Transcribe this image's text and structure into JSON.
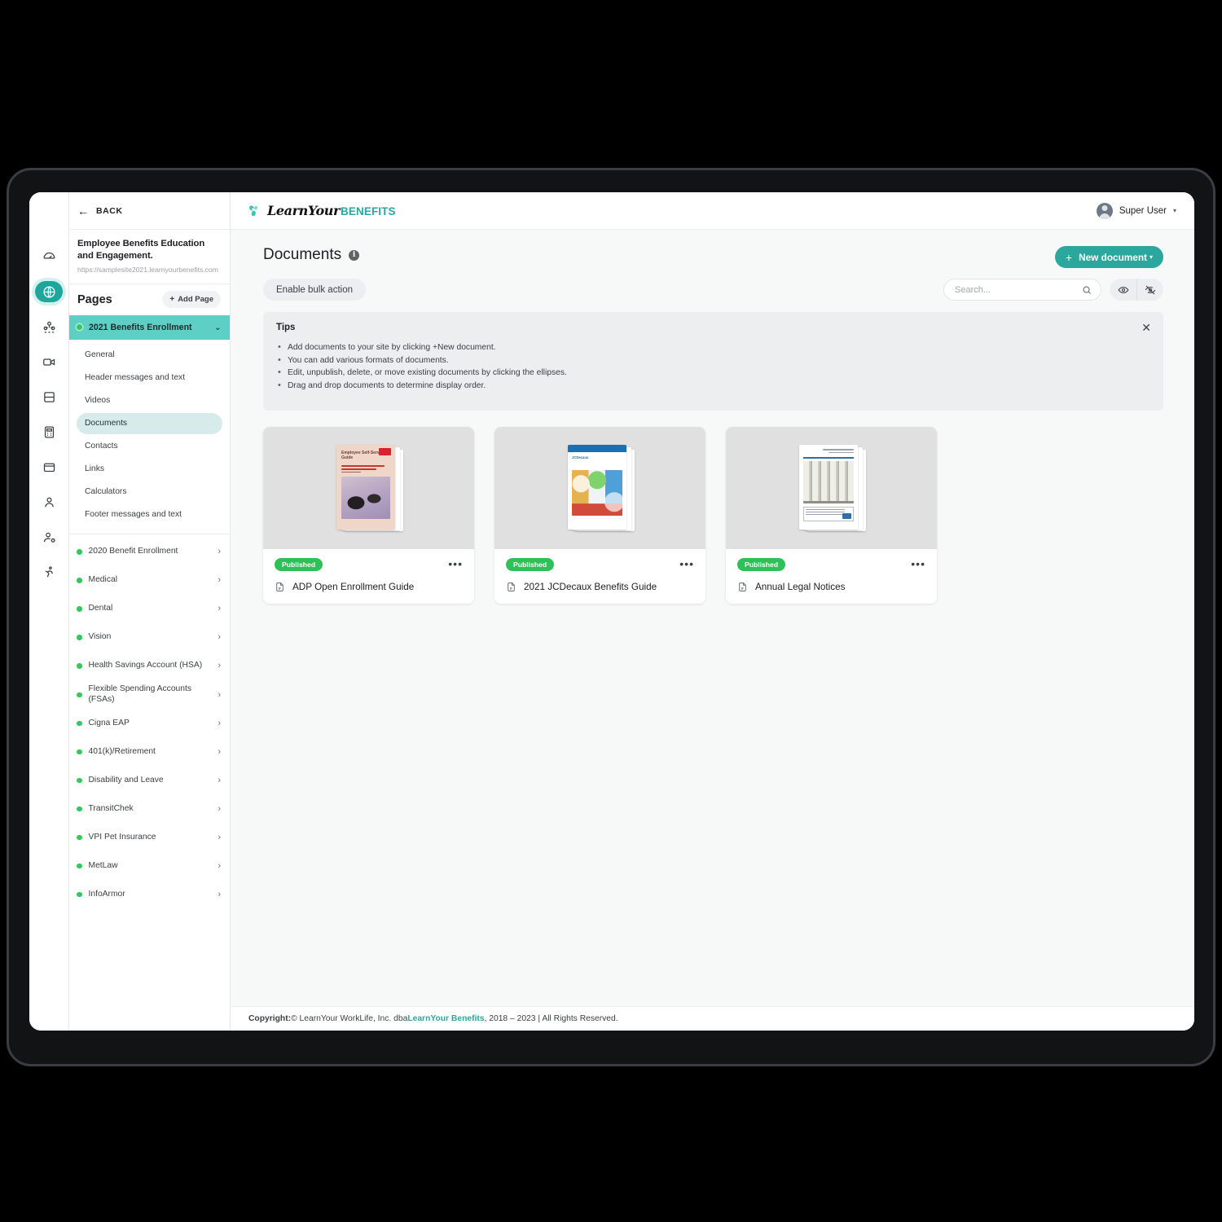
{
  "rail": {
    "items": [
      {
        "name": "dashboard-icon",
        "label": "Dashboard"
      },
      {
        "name": "globe-icon",
        "label": "Sites",
        "active": true
      },
      {
        "name": "people-group-icon",
        "label": "Groups"
      },
      {
        "name": "video-icon",
        "label": "Videos"
      },
      {
        "name": "cards-icon",
        "label": "Cards"
      },
      {
        "name": "calculator-icon",
        "label": "Calculators"
      },
      {
        "name": "folder-icon",
        "label": "Library"
      },
      {
        "name": "user-icon",
        "label": "Users"
      },
      {
        "name": "user-settings-icon",
        "label": "User settings"
      },
      {
        "name": "activity-icon",
        "label": "Activity"
      }
    ]
  },
  "sidebar": {
    "back_label": "BACK",
    "site_title": "Employee Benefits Education and Engagement.",
    "site_url": "https://samplesite2021.learnyourbenefits.com",
    "pages_heading": "Pages",
    "add_page_label": "Add Page",
    "add_page_plus": "+",
    "active_page": "2021 Benefits Enrollment",
    "subpages": [
      {
        "label": "General",
        "selected": false
      },
      {
        "label": "Header messages and text",
        "selected": false
      },
      {
        "label": "Videos",
        "selected": false
      },
      {
        "label": "Documents",
        "selected": true
      },
      {
        "label": "Contacts",
        "selected": false
      },
      {
        "label": "Links",
        "selected": false
      },
      {
        "label": "Calculators",
        "selected": false
      },
      {
        "label": "Footer messages and text",
        "selected": false
      }
    ],
    "groups": [
      {
        "label": "2020 Benefit Enrollment"
      },
      {
        "label": "Medical"
      },
      {
        "label": "Dental"
      },
      {
        "label": "Vision"
      },
      {
        "label": "Health Savings Account (HSA)"
      },
      {
        "label": "Flexible Spending Accounts (FSAs)"
      },
      {
        "label": "Cigna EAP"
      },
      {
        "label": "401(k)/Retirement"
      },
      {
        "label": "Disability and Leave"
      },
      {
        "label": "TransitChek"
      },
      {
        "label": "VPI Pet Insurance"
      },
      {
        "label": "MetLaw"
      },
      {
        "label": "InfoArmor"
      }
    ]
  },
  "header": {
    "brand_primary": "LearnYour",
    "brand_secondary": "BENEFITS",
    "user_name": "Super User",
    "user_caret": "▾"
  },
  "main": {
    "page_title": "Documents",
    "info_badge": "i",
    "new_document_label": "New document",
    "new_document_plus": "+",
    "new_document_caret": "▾",
    "bulk_action_label": "Enable bulk action",
    "search_placeholder": "Search...",
    "search_value": ""
  },
  "tips": {
    "title": "Tips",
    "close_label": "✕",
    "items": [
      "Add documents to your site by clicking +New document.",
      "You can add various formats of documents.",
      "Edit, unpublish, delete, or move existing documents by clicking the ellipses.",
      "Drag and drop documents to determine display order."
    ]
  },
  "documents": [
    {
      "name": "ADP Open Enrollment Guide",
      "status": "Published",
      "menu": "•••",
      "cover": "adp",
      "cover_text": {
        "heading": "Employee Self-Service Guide"
      }
    },
    {
      "name": "2021 JCDecaux Benefits Guide",
      "status": "Published",
      "menu": "•••",
      "cover": "jcdecaux",
      "cover_text": {
        "brand": "JCDecaux"
      }
    },
    {
      "name": "Annual Legal Notices",
      "status": "Published",
      "menu": "•••",
      "cover": "legal",
      "cover_text": {
        "brand": ""
      }
    }
  ],
  "footer": {
    "label": "Copyright:",
    "text_before": " © LearnYour WorkLife, Inc. dba ",
    "brand": "LearnYour Benefits",
    "text_after": ", 2018 – 2023 | All Rights Reserved."
  },
  "colors": {
    "accent_teal": "#2ba79e",
    "active_page_bg": "#5ecfc4",
    "status_green": "#2fc158",
    "dot_green": "#34c759"
  }
}
